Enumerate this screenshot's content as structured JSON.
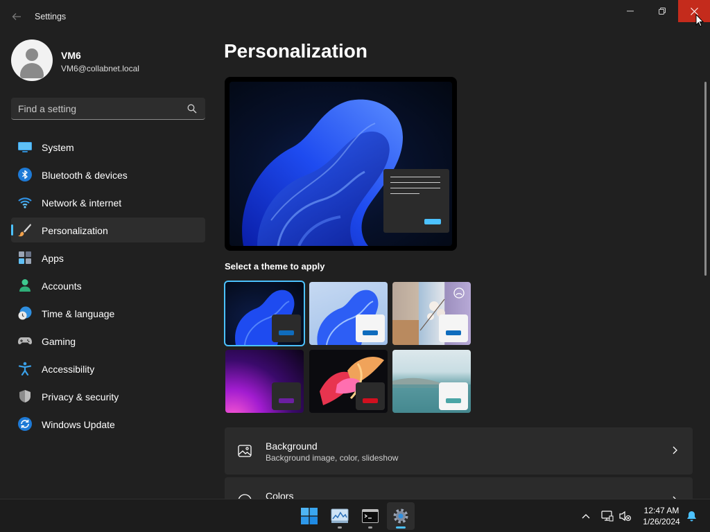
{
  "window": {
    "title": "Settings"
  },
  "profile": {
    "name": "VM6",
    "email": "VM6@collabnet.local"
  },
  "search": {
    "placeholder": "Find a setting"
  },
  "sidebar": {
    "items": [
      {
        "label": "System",
        "icon": "monitor-icon",
        "active": false
      },
      {
        "label": "Bluetooth & devices",
        "icon": "bluetooth-icon",
        "active": false
      },
      {
        "label": "Network & internet",
        "icon": "wifi-icon",
        "active": false
      },
      {
        "label": "Personalization",
        "icon": "paintbrush-icon",
        "active": true
      },
      {
        "label": "Apps",
        "icon": "apps-icon",
        "active": false
      },
      {
        "label": "Accounts",
        "icon": "person-icon",
        "active": false
      },
      {
        "label": "Time & language",
        "icon": "globe-clock-icon",
        "active": false
      },
      {
        "label": "Gaming",
        "icon": "gamepad-icon",
        "active": false
      },
      {
        "label": "Accessibility",
        "icon": "accessibility-icon",
        "active": false
      },
      {
        "label": "Privacy & security",
        "icon": "shield-icon",
        "active": false
      },
      {
        "label": "Windows Update",
        "icon": "update-icon",
        "active": false
      }
    ]
  },
  "main": {
    "title": "Personalization",
    "theme_heading": "Select a theme to apply",
    "themes": [
      {
        "name": "windows-dark",
        "accent": "#0f6cbd",
        "selected": true
      },
      {
        "name": "windows-light",
        "accent": "#0f6cbd",
        "selected": false
      },
      {
        "name": "spotlight",
        "accent": "#0f6cbd",
        "selected": false
      },
      {
        "name": "glow",
        "accent": "#6b1fa0",
        "selected": false
      },
      {
        "name": "captured-motion",
        "accent": "#d1101f",
        "selected": false
      },
      {
        "name": "flow",
        "accent": "#4aa5a6",
        "selected": false
      }
    ],
    "cards": [
      {
        "title": "Background",
        "subtitle": "Background image, color, slideshow",
        "icon": "image-icon"
      },
      {
        "title": "Colors",
        "subtitle": "",
        "icon": "palette-icon"
      }
    ]
  },
  "taskbar": {
    "apps": [
      "start-icon",
      "task-manager-icon",
      "terminal-icon",
      "settings-icon"
    ],
    "time": "12:47 AM",
    "date": "1/26/2024"
  },
  "colors": {
    "accent": "#4cc2ff",
    "close": "#c42b1c",
    "background": "#202020"
  }
}
